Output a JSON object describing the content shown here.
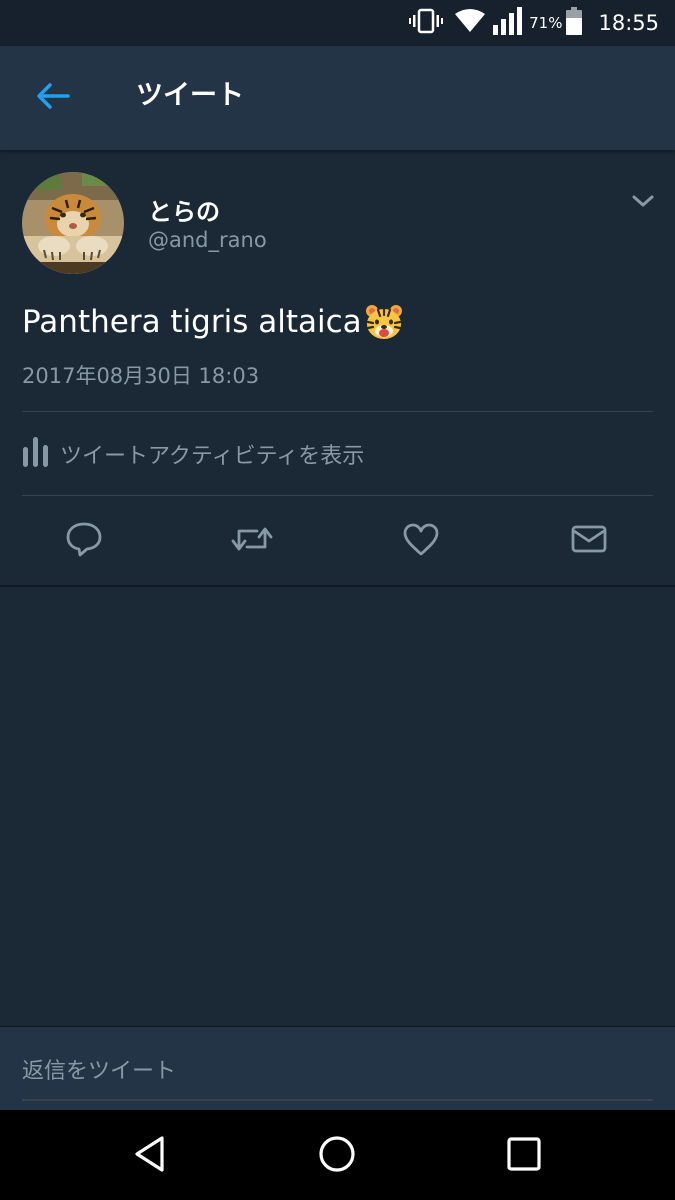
{
  "status_bar": {
    "battery_percent": "71%",
    "time": "18:55"
  },
  "header": {
    "title": "ツイート"
  },
  "tweet": {
    "display_name": "とらの",
    "handle": "@and_rano",
    "text": "Panthera tigris altaica",
    "emoji": "tiger-face",
    "timestamp": "2017年08月30日 18:03",
    "activity_label": "ツイートアクティビティを表示",
    "actions": [
      "reply-icon",
      "retweet-icon",
      "like-icon",
      "direct-message-icon"
    ]
  },
  "reply": {
    "placeholder": "返信をツイート"
  },
  "colors": {
    "background": "#1b2836",
    "header": "#243447",
    "accent": "#1da1f2",
    "muted_text": "#8899a6"
  }
}
